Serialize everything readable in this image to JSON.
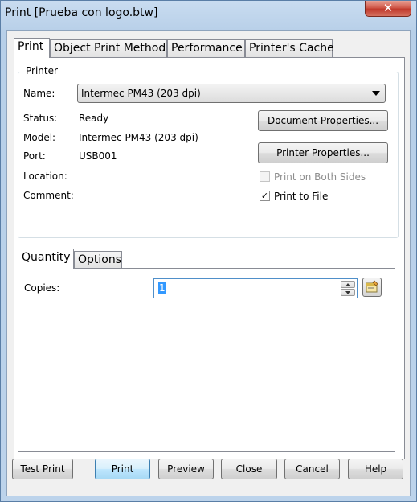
{
  "window": {
    "title": "Print [Prueba con logo.btw]",
    "close_glyph": "✕"
  },
  "tabs": [
    {
      "label": "Print",
      "active": true
    },
    {
      "label": "Object Print Method",
      "active": false
    },
    {
      "label": "Performance",
      "active": false
    },
    {
      "label": "Printer's Cache",
      "active": false
    }
  ],
  "printer": {
    "group_label": "Printer",
    "name_label": "Name:",
    "name_value": "Intermec PM43 (203 dpi)",
    "status_label": "Status:",
    "status_value": "Ready",
    "model_label": "Model:",
    "model_value": "Intermec PM43 (203 dpi)",
    "port_label": "Port:",
    "port_value": "USB001",
    "location_label": "Location:",
    "comment_label": "Comment:",
    "document_properties_label": "Document Properties...",
    "printer_properties_label": "Printer Properties...",
    "both_sides_label": "Print on Both Sides",
    "both_sides_checked": false,
    "both_sides_enabled": false,
    "to_file_label": "Print to File",
    "to_file_checked": true,
    "check_glyph": "✓"
  },
  "inner_tabs": [
    {
      "label": "Quantity",
      "active": true
    },
    {
      "label": "Options",
      "active": false
    }
  ],
  "quantity": {
    "copies_label": "Copies:",
    "copies_value": "1"
  },
  "footer": {
    "test_print": "Test Print",
    "print": "Print",
    "preview": "Preview",
    "close": "Close",
    "cancel": "Cancel",
    "help": "Help"
  },
  "colors": {
    "accent": "#3399ff",
    "close_button": "#c0392b"
  }
}
